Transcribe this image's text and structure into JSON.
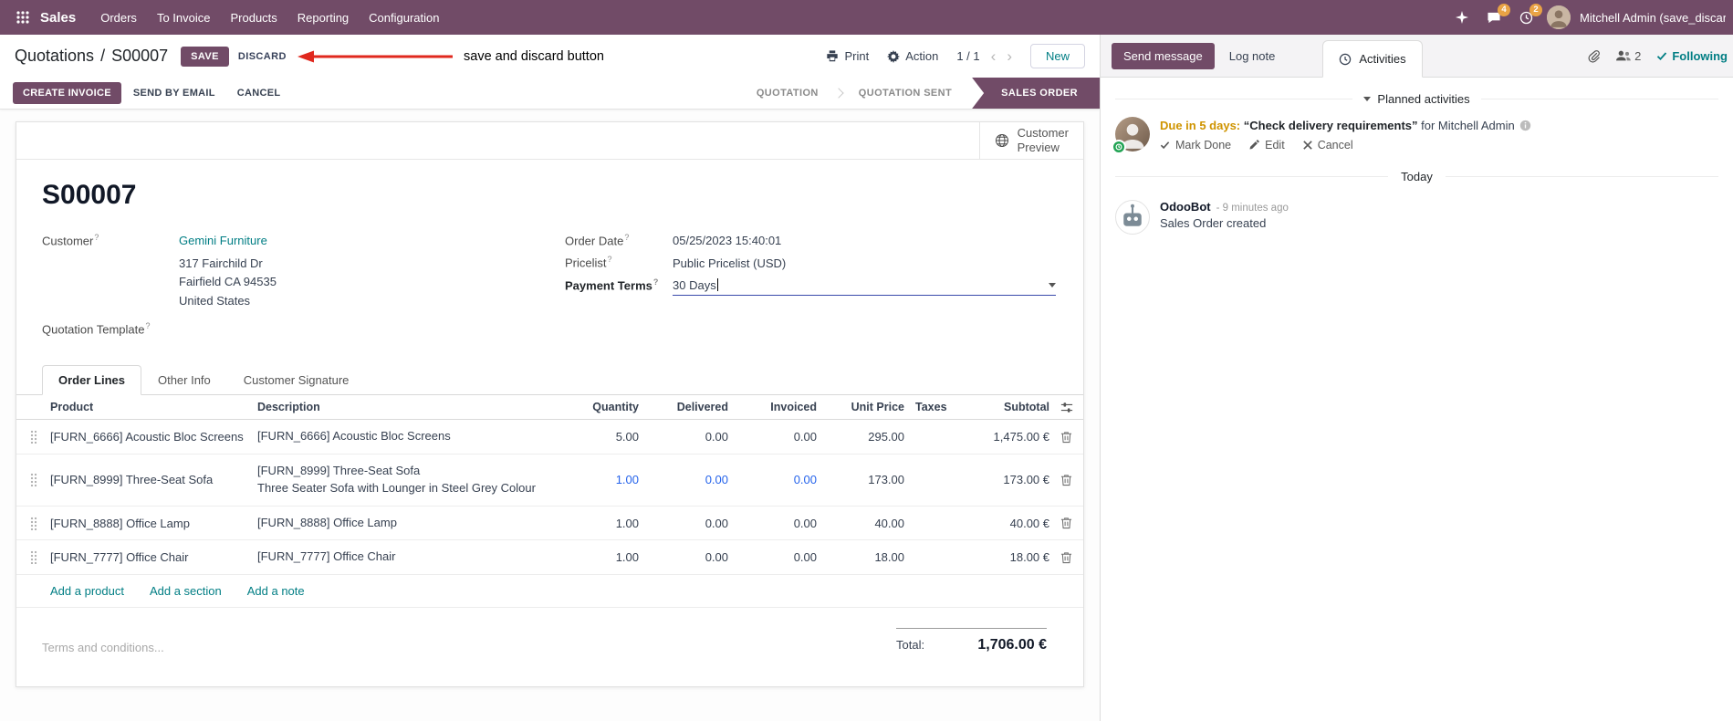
{
  "topbar": {
    "app_name": "Sales",
    "menus": [
      "Orders",
      "To Invoice",
      "Products",
      "Reporting",
      "Configuration"
    ],
    "messages_badge": "4",
    "activities_badge": "2",
    "user_name": "Mitchell Admin (save_discar"
  },
  "breadcrumb": {
    "parent": "Quotations",
    "separator": "/",
    "current": "S00007"
  },
  "actions": {
    "save": "SAVE",
    "discard": "DISCARD",
    "print": "Print",
    "action": "Action",
    "pager": "1 / 1",
    "new": "New"
  },
  "annotation": {
    "label": "save and discard button"
  },
  "statusbar": {
    "create_invoice": "CREATE INVOICE",
    "send_by_email": "SEND BY EMAIL",
    "cancel": "CANCEL",
    "stages": [
      {
        "label": "QUOTATION"
      },
      {
        "label": "QUOTATION SENT"
      },
      {
        "label": "SALES ORDER"
      }
    ]
  },
  "form": {
    "customer_preview_line1": "Customer",
    "customer_preview_line2": "Preview",
    "title": "S00007",
    "help_mark": "?",
    "left": {
      "customer_label": "Customer",
      "customer_value": "Gemini Furniture",
      "address_line1": "317 Fairchild Dr",
      "address_line2": "Fairfield CA 94535",
      "address_line3": "United States",
      "quotation_template_label": "Quotation Template"
    },
    "right": {
      "order_date_label": "Order Date",
      "order_date_value": "05/25/2023 15:40:01",
      "pricelist_label": "Pricelist",
      "pricelist_value": "Public Pricelist (USD)",
      "payment_terms_label": "Payment Terms",
      "payment_terms_value": "30 Days"
    },
    "tabs": [
      "Order Lines",
      "Other Info",
      "Customer Signature"
    ],
    "table": {
      "headers": {
        "product": "Product",
        "description": "Description",
        "quantity": "Quantity",
        "delivered": "Delivered",
        "invoiced": "Invoiced",
        "unit_price": "Unit Price",
        "taxes": "Taxes",
        "subtotal": "Subtotal"
      },
      "rows": [
        {
          "product": "[FURN_6666] Acoustic Bloc Screens",
          "description": "[FURN_6666] Acoustic Bloc Screens",
          "description2": "",
          "quantity": "5.00",
          "delivered": "0.00",
          "invoiced": "0.00",
          "unit_price": "295.00",
          "taxes": "",
          "subtotal": "1,475.00 €"
        },
        {
          "product": "[FURN_8999] Three-Seat Sofa",
          "description": "[FURN_8999] Three-Seat Sofa",
          "description2": "Three Seater Sofa with Lounger in Steel Grey Colour",
          "quantity": "1.00",
          "delivered": "0.00",
          "invoiced": "0.00",
          "unit_price": "173.00",
          "taxes": "",
          "subtotal": "173.00 €"
        },
        {
          "product": "[FURN_8888] Office Lamp",
          "description": "[FURN_8888] Office Lamp",
          "description2": "",
          "quantity": "1.00",
          "delivered": "0.00",
          "invoiced": "0.00",
          "unit_price": "40.00",
          "taxes": "",
          "subtotal": "40.00 €"
        },
        {
          "product": "[FURN_7777] Office Chair",
          "description": "[FURN_7777] Office Chair",
          "description2": "",
          "quantity": "1.00",
          "delivered": "0.00",
          "invoiced": "0.00",
          "unit_price": "18.00",
          "taxes": "",
          "subtotal": "18.00 €"
        }
      ],
      "links": {
        "add_product": "Add a product",
        "add_section": "Add a section",
        "add_note": "Add a note"
      }
    },
    "terms_placeholder": "Terms and conditions...",
    "total_label": "Total:",
    "total_value": "1,706.00 €"
  },
  "chatter": {
    "send_message": "Send message",
    "log_note": "Log note",
    "activities_tab": "Activities",
    "followers_count": "2",
    "following": "Following",
    "planned_activities_title": "Planned activities",
    "activity": {
      "due": "Due in 5 days:",
      "summary": "“Check delivery requirements”",
      "assignee": "for Mitchell Admin",
      "mark_done": "Mark Done",
      "edit": "Edit",
      "cancel": "Cancel"
    },
    "date_divider": "Today",
    "message": {
      "author": "OdooBot",
      "time": "- 9 minutes ago",
      "body": "Sales Order created"
    }
  },
  "colors": {
    "brand": "#714B67",
    "link_teal": "#017E84",
    "modified_value_blue": "#2563eb",
    "due_amber": "#cf9400",
    "badge_orange": "#e9a345",
    "annotation_red": "#e0281e",
    "stage_active_bg": "#714B67"
  }
}
